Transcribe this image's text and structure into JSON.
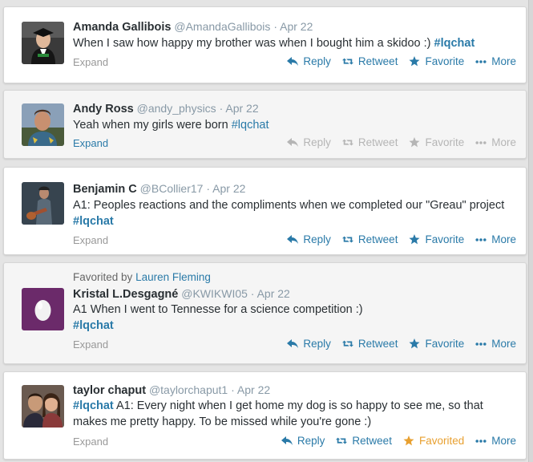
{
  "tweets": [
    {
      "fullname": "Amanda Gallibois",
      "username": "@AmandaGallibois",
      "time": "Apr 22",
      "text_before": "When I saw how happy my brother was when I bought him a skidoo :) ",
      "hashtag": "#lqchat",
      "text_after": "",
      "expand": "Expand",
      "actions": {
        "reply": "Reply",
        "retweet": "Retweet",
        "favorite": "Favorite",
        "more": "More"
      }
    },
    {
      "fullname": "Andy Ross",
      "username": "@andy_physics",
      "time": "Apr 22",
      "text_before": "Yeah when my  girls were born ",
      "hashtag": "#lqchat",
      "text_after": "",
      "expand": "Expand",
      "actions": {
        "reply": "Reply",
        "retweet": "Retweet",
        "favorite": "Favorite",
        "more": "More"
      }
    },
    {
      "fullname": "Benjamin C",
      "username": "@BCollier17",
      "time": "Apr 22",
      "text_before": "A1: Peoples reactions and the compliments when we completed our \"Greau\" project ",
      "hashtag": "#lqchat",
      "text_after": "",
      "expand": "Expand",
      "actions": {
        "reply": "Reply",
        "retweet": "Retweet",
        "favorite": "Favorite",
        "more": "More"
      }
    },
    {
      "favorited_by_label": "Favorited by",
      "favorited_by_name": "Lauren Fleming",
      "fullname": "Kristal L.Desgagné",
      "username": "@KWIKWI05",
      "time": "Apr 22",
      "text_before": "A1 When I went to Tennesse for a science competition :) ",
      "hashtag": "#lqchat",
      "text_after": "",
      "expand": "Expand",
      "actions": {
        "reply": "Reply",
        "retweet": "Retweet",
        "favorite": "Favorite",
        "more": "More"
      }
    },
    {
      "fullname": "taylor chaput",
      "username": "@taylorchaput1",
      "time": "Apr 22",
      "text_before": "",
      "hashtag": "#lqchat",
      "text_after": " A1: Every night when I get home my dog is so happy to see me, so that makes me pretty happy. To be missed while you're gone :)",
      "expand": "Expand",
      "actions": {
        "reply": "Reply",
        "retweet": "Retweet",
        "favorite": "Favorited",
        "more": "More"
      }
    }
  ],
  "separator": "·",
  "colors": {
    "link": "#2a7aa8",
    "muted": "#8899a6",
    "favorited": "#e8a030",
    "egg_bg": "#6b2a6a"
  },
  "icons": {
    "reply": "reply-arrow-icon",
    "retweet": "retweet-icon",
    "favorite": "star-icon",
    "more": "ellipsis-icon"
  }
}
